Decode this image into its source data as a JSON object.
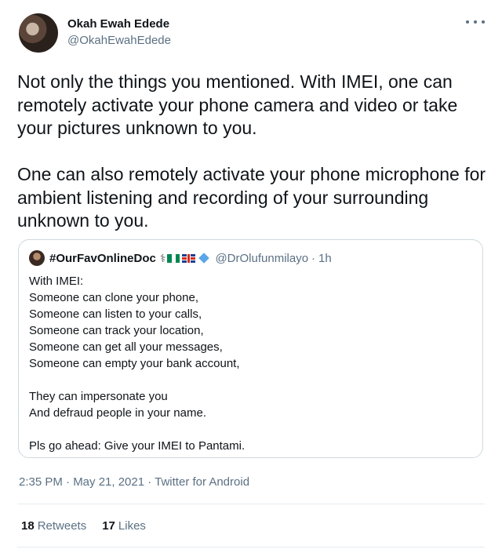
{
  "author": {
    "display_name": "Okah Ewah Edede",
    "handle": "@OkahEwahEdede"
  },
  "more_icon": "more-horizontal-icon",
  "body_text": "Not only the things you mentioned. With IMEI, one can remotely activate your phone camera and video or take your pictures unknown to you.\n\nOne can also remotely activate your phone microphone for ambient listening and recording of your surrounding unknown to you.",
  "quoted": {
    "display_name": "#OurFavOnlineDoc",
    "emoji_icons": [
      "stethoscope-icon",
      "nigeria-flag-icon",
      "uk-flag-icon",
      "diamond-icon"
    ],
    "handle": "@DrOlufunmilayo",
    "separator": "·",
    "time": "1h",
    "text": "With IMEI:\nSomeone can clone your phone,\nSomeone can listen to your calls,\nSomeone can track your location,\nSomeone can get all your messages,\nSomeone can empty your bank account,\n\nThey can impersonate you\nAnd defraud people in your name.\n\nPls go ahead: Give your IMEI to Pantami."
  },
  "meta": "2:35 PM · May 21, 2021 · Twitter for Android",
  "stats": {
    "retweets_count": "18",
    "retweets_label": "Retweets",
    "likes_count": "17",
    "likes_label": "Likes"
  },
  "colors": {
    "text": "#0f1419",
    "secondary": "#5b7083",
    "border": "#cfd9de",
    "nigeria_green": "#008751",
    "diamond_blue": "#5aa6e6"
  }
}
